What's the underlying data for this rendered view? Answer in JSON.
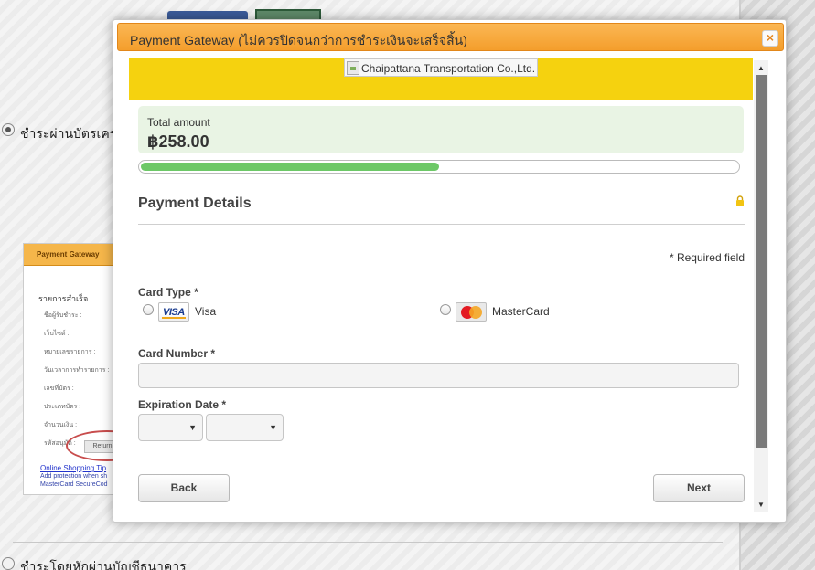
{
  "background": {
    "credit_option_label": "ชำระผ่านบัตรเครดิต",
    "bank_option_label": "ชำระโดยหักผ่านบัญชีธนาคาร",
    "thumbnail": {
      "header": "Payment Gateway",
      "title": "รายการสำเร็จ",
      "rows": [
        "ชื่อผู้รับชำระ :",
        "เว็บไซต์ :",
        "หมายเลขรายการ :",
        "วันเวลาการทำรายการ :",
        "เลขที่บัตร :",
        "ประเภทบัตร :",
        "จำนวนเงิน :",
        "รหัสอนุมัติ :"
      ],
      "return_label": "Return",
      "link": "Online Shopping Tip",
      "small1": "Add protection when sh",
      "small2": "MasterCard SecureCod"
    }
  },
  "modal": {
    "title": "Payment Gateway (ไม่ควรปิดจนกว่าการชำระเงินจะเสร็จสิ้น)",
    "close_label": "×",
    "brand_alt": "Chaipattana Transportation Co.,Ltd.",
    "brand_color": "#f5d20f",
    "total": {
      "label": "Total amount",
      "amount": "฿258.00"
    },
    "progress_fraction": 0.5,
    "section_title": "Payment Details",
    "required_note": "* Required field",
    "card_type_label": "Card Type *",
    "card_options": [
      {
        "name": "Visa",
        "logo": "visa-logo"
      },
      {
        "name": "MasterCard",
        "logo": "mastercard-logo"
      }
    ],
    "card_number_label": "Card Number *",
    "card_number_value": "",
    "expiration_label": "Expiration Date *",
    "expiry_month": "",
    "expiry_year": "",
    "back_label": "Back",
    "next_label": "Next",
    "colors": {
      "header": "#f7a83a",
      "progress": "#6dc867",
      "total_bg": "#e9f4e4"
    }
  }
}
